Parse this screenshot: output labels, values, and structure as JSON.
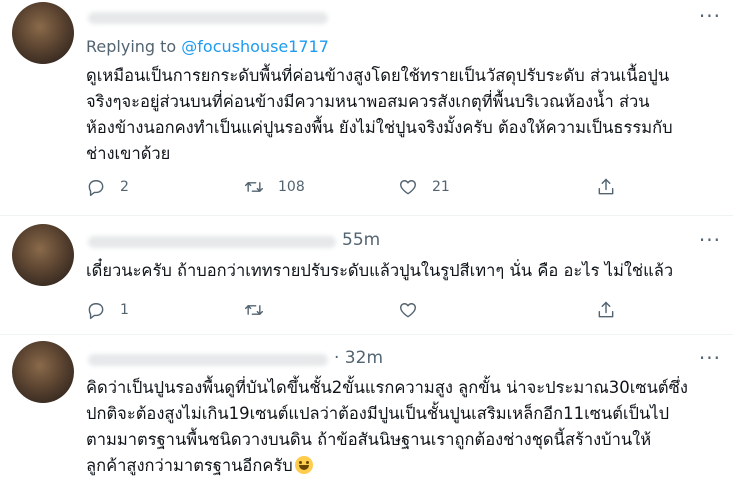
{
  "tweets": [
    {
      "time": "",
      "replying_to_label": "Replying to",
      "replying_to_handle": "@focushouse1717",
      "lines": [
        "ดูเหมือนเป็นการยกระดับพื้นที่ค่อนข้างสูงโดยใช้ทรายเป็นวัสดุปรับระดับ ส่วนเนื้อปูน",
        "จริงๆจะอยู่ส่วนบนที่ค่อนข้างมีความหนาพอสมควรสังเกตุที่พื้นบริเวณห้องน้ำ ส่วน",
        "ห้องข้างนอกคงทำเป็นแค่ปูนรองพื้น ยังไม่ใช่ปูนจริงมั้งครับ ต้องให้ความเป็นธรรมกับ",
        "ช่างเขาด้วย"
      ],
      "reply_count": "2",
      "retweet_count": "108",
      "like_count": "21",
      "share_count": ""
    },
    {
      "time": "55m",
      "lines": [
        "เดี๋ยวนะครับ ถ้าบอกว่าเททรายปรับระดับแล้วปูนในรูปสีเทาๆ นั่น คือ อะไร ไม่ใช่แล้ว"
      ],
      "reply_count": "1",
      "retweet_count": "",
      "like_count": "",
      "share_count": ""
    },
    {
      "time": "· 32m",
      "lines": [
        "คิดว่าเป็นปูนรองพื้นดูที่บันไดขึ้นชั้น2ขั้นแรกความสูง ลูกขั้น น่าจะประมาณ30เซนต์ซึ่ง",
        "ปกติจะต้องสูงไม่เกิน19เซนต์แปลว่าต้องมีปูนเป็นชั้นปูนเสริมเหล็กอีก11เซนต์เป็นไป",
        "ตามมาตรฐานพื้นชนิดวางบนดิน ถ้าข้อสันนิษฐานเราถูกต้องช่างชุดนี้สร้างบ้านให้",
        "ลูกค้าสูงกว่ามาตรฐานอีกครับ"
      ],
      "emoji": "grinning-face-emoji"
    }
  ],
  "more_label": "···",
  "colors": {
    "accent": "#1d9bf0",
    "secondary_text": "#536471",
    "divider": "#eff3f4"
  }
}
